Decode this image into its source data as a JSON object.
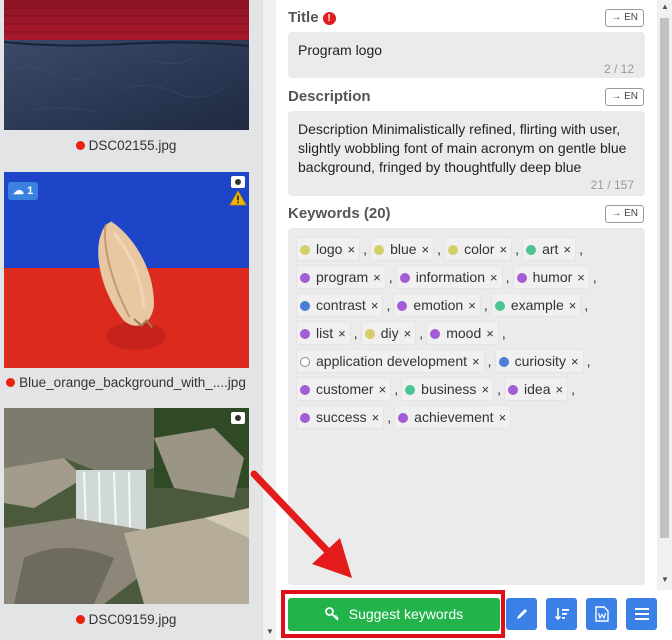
{
  "gallery": {
    "items": [
      {
        "filename": "DSC02155.jpg",
        "status_color": "#e8200c"
      },
      {
        "filename": "Blue_orange_background_with_....jpg",
        "status_color": "#e8200c",
        "cloud_count": "1"
      },
      {
        "filename": "DSC09159.jpg",
        "status_color": "#e8200c"
      }
    ]
  },
  "title": {
    "label": "Title",
    "lang": "→ EN",
    "value": "Program logo",
    "counter": "2 / 12"
  },
  "description": {
    "label": "Description",
    "lang": "→ EN",
    "value": "Description Minimalistically refined, flirting with user, slightly wobbling font of main acronym on gentle blue background, fringed by thoughtfully deep blue",
    "counter": "21 / 157"
  },
  "keywords": {
    "label": "Keywords (20)",
    "lang": "→ EN",
    "rows": [
      [
        {
          "text": "logo",
          "color": "#d4cf6a"
        },
        {
          "text": "blue",
          "color": "#d4cf6a"
        },
        {
          "text": "color",
          "color": "#d4cf6a"
        },
        {
          "text": "art",
          "color": "#4cc490"
        }
      ],
      [
        {
          "text": "program",
          "color": "#a35bd6"
        },
        {
          "text": "information",
          "color": "#a35bd6"
        },
        {
          "text": "humor",
          "color": "#a35bd6"
        }
      ],
      [
        {
          "text": "contrast",
          "color": "#4a7fd4"
        },
        {
          "text": "emotion",
          "color": "#a35bd6"
        },
        {
          "text": "example",
          "color": "#4cc490"
        }
      ],
      [
        {
          "text": "list",
          "color": "#a35bd6"
        },
        {
          "text": "diy",
          "color": "#d4cf6a"
        },
        {
          "text": "mood",
          "color": "#a35bd6"
        }
      ],
      [
        {
          "text": "application development",
          "color": "#ffffff"
        },
        {
          "text": "curiosity",
          "color": "#4a7fd4"
        }
      ],
      [
        {
          "text": "customer",
          "color": "#a35bd6"
        },
        {
          "text": "business",
          "color": "#4cc490"
        },
        {
          "text": "idea",
          "color": "#a35bd6"
        }
      ],
      [
        {
          "text": "success",
          "color": "#a35bd6"
        },
        {
          "text": "achievement",
          "color": "#a35bd6"
        }
      ]
    ],
    "remove_glyph": "×",
    "separator": ","
  },
  "actions": {
    "suggest_label": "Suggest keywords",
    "accent_green": "#22b34a",
    "accent_blue": "#3b80e6",
    "highlight_red": "#e0101a"
  }
}
